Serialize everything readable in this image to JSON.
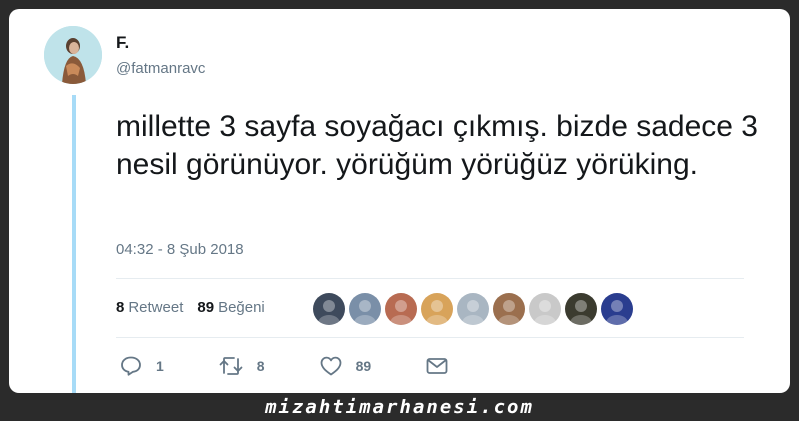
{
  "tweet": {
    "display_name": "F.",
    "handle": "@fatmanravc",
    "text": "millette 3 sayfa soyağacı çıkmış. bizde sadece 3 nesil görünüyor. yörüğüm yörüğüz yörüking.",
    "timestamp": "04:32 - 8 Şub 2018",
    "retweet_count": "8",
    "retweet_label": "Retweet",
    "like_count": "89",
    "like_label": "Beğeni"
  },
  "actions": {
    "reply_count": "1",
    "retweet_count": "8",
    "like_count": "89"
  },
  "likers": [
    {
      "name": "liker-avatar-1",
      "color": "#3e4a5c"
    },
    {
      "name": "liker-avatar-2",
      "color": "#7a8fa8"
    },
    {
      "name": "liker-avatar-3",
      "color": "#b86b52"
    },
    {
      "name": "liker-avatar-4",
      "color": "#d8a35a"
    },
    {
      "name": "liker-avatar-5",
      "color": "#a9b6c2"
    },
    {
      "name": "liker-avatar-6",
      "color": "#9b6f4e"
    },
    {
      "name": "liker-avatar-7",
      "color": "#c9c9c9"
    },
    {
      "name": "liker-avatar-8",
      "color": "#3b3b2f"
    },
    {
      "name": "liker-avatar-9",
      "color": "#2a3d8f"
    }
  ],
  "icons": {
    "reply": "reply-icon",
    "retweet": "retweet-icon",
    "like": "heart-icon",
    "message": "direct-message-icon"
  },
  "watermark": "mizahtimarhanesi.com",
  "colors": {
    "background": "#2b2b2b",
    "card": "#ffffff",
    "thread_line": "#a7dbf7",
    "secondary_text": "#657786",
    "primary_text": "#14171a"
  }
}
